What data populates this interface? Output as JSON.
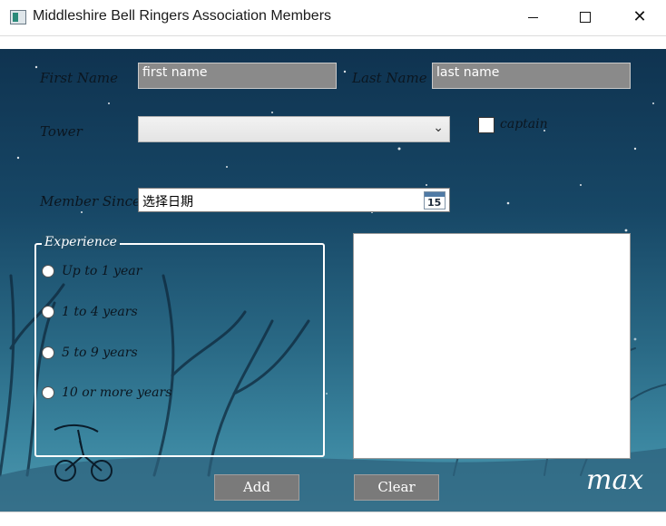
{
  "window": {
    "title": "Middleshire Bell Ringers Association Members",
    "min_glyph": "",
    "max_glyph": "",
    "close_glyph": "✕"
  },
  "form": {
    "first_name_label": "First Name",
    "first_name_value": "first name",
    "last_name_label": "Last Name",
    "last_name_value": "last name",
    "tower_label": "Tower",
    "tower_selected": "",
    "captain_label": "captain",
    "member_since_label": "Member Since",
    "member_since_value": "选择日期",
    "calendar_day": "15"
  },
  "experience": {
    "legend": "Experience",
    "options": [
      "Up to 1 year",
      "1 to 4 years",
      "5 to 9 years",
      "10 or more years"
    ]
  },
  "buttons": {
    "add": "Add",
    "clear": "Clear"
  },
  "signature": "max",
  "colors": {
    "field_bg": "#8a8a8a",
    "button_bg": "#7a7a7a",
    "scene_top": "#0f3350",
    "scene_bottom": "#4e98ae"
  }
}
